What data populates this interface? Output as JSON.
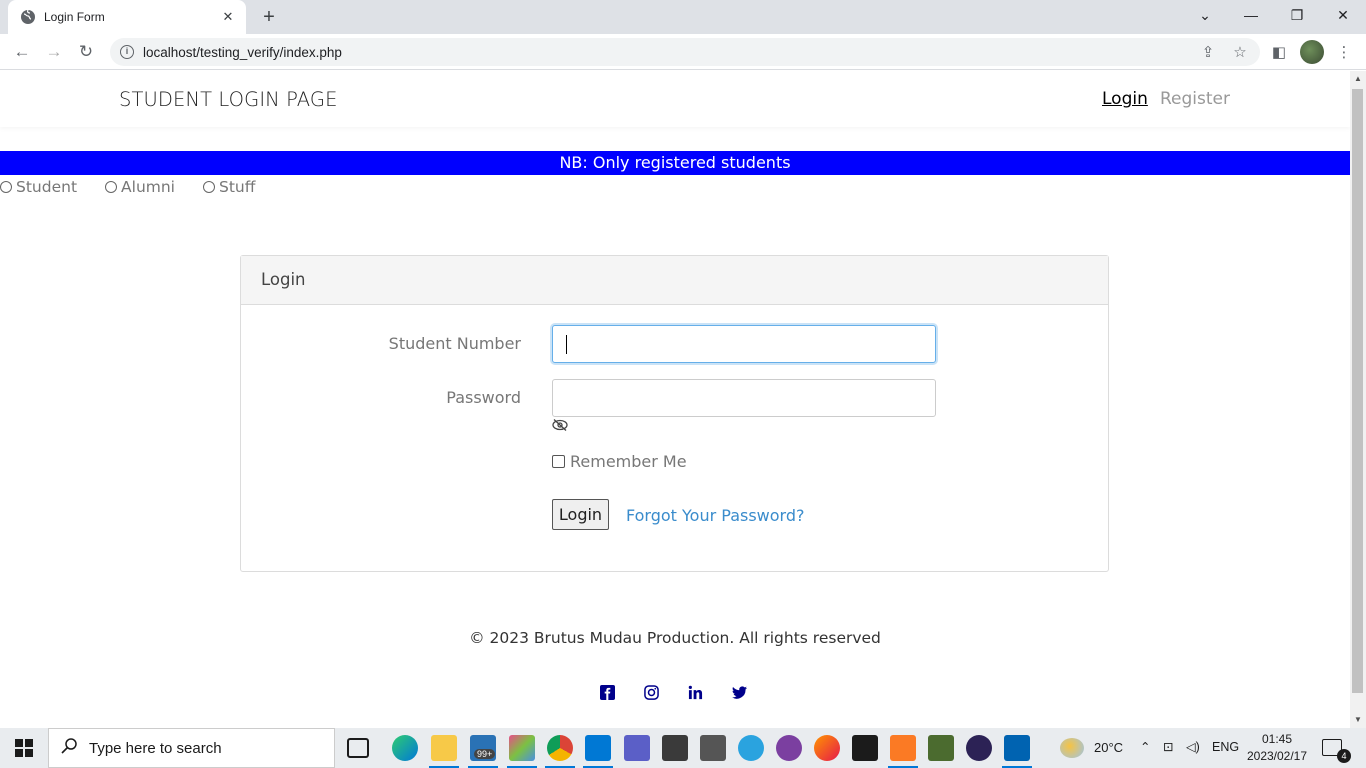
{
  "browser": {
    "tab_title": "Login Form",
    "url": "localhost/testing_verify/index.php"
  },
  "site": {
    "brand": "STUDENT LOGIN PAGE",
    "nav_login": "Login",
    "nav_register": "Register"
  },
  "notice": "NB: Only registered students",
  "roles": [
    "Student",
    "Alumni",
    "Stuff"
  ],
  "form": {
    "header": "Login",
    "student_number_label": "Student Number",
    "student_number_value": "",
    "password_label": "Password",
    "password_value": "",
    "remember_label": "Remember Me",
    "remember_checked": false,
    "login_button": "Login",
    "forgot_link": "Forgot Your Password?"
  },
  "footer": {
    "copyright": "© 2023 Brutus Mudau Production. All rights reserved",
    "social_icons": [
      "facebook-icon",
      "instagram-icon",
      "linkedin-icon",
      "twitter-icon"
    ],
    "social_color": "#00008b"
  },
  "notice_bg": "#0000ff",
  "taskbar": {
    "search_placeholder": "Type here to search",
    "mail_badge": "99+",
    "temperature": "20°C",
    "language": "ENG",
    "time": "01:45",
    "date": "2023/02/17",
    "notification_count": "4"
  }
}
